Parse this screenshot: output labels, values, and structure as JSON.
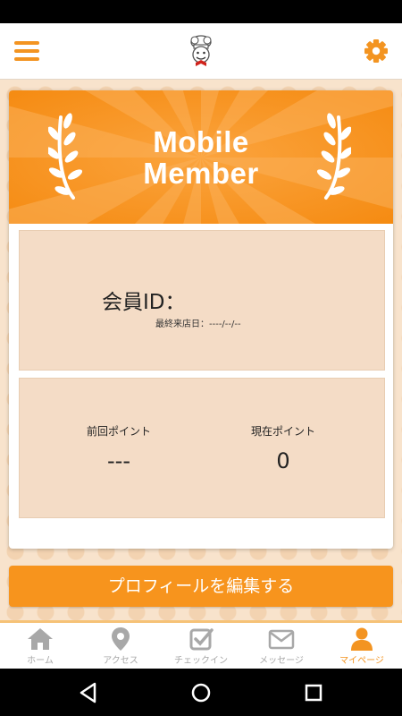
{
  "header": {
    "menu_icon": "hamburger-menu-icon",
    "logo": "chef-mascot-logo",
    "settings_icon": "gear-icon"
  },
  "banner": {
    "title_line1": "Mobile",
    "title_line2": "Member"
  },
  "member": {
    "id_label": "会員ID：",
    "id_value": "",
    "last_visit": "最終来店日：----/--/--"
  },
  "points": {
    "previous_label": "前回ポイント",
    "previous_value": "---",
    "current_label": "現在ポイント",
    "current_value": "0"
  },
  "edit_profile_label": "プロフィールを編集する",
  "tabs": [
    {
      "label": "ホーム",
      "icon": "home-icon",
      "active": false
    },
    {
      "label": "アクセス",
      "icon": "map-pin-icon",
      "active": false
    },
    {
      "label": "チェックイン",
      "icon": "checkbox-icon",
      "active": false
    },
    {
      "label": "メッセージ",
      "icon": "envelope-icon",
      "active": false
    },
    {
      "label": "マイページ",
      "icon": "person-icon",
      "active": true
    }
  ],
  "colors": {
    "accent": "#f7941d",
    "inactive_tab": "#a8a8a8",
    "panel_bg": "#f4dcc6"
  }
}
